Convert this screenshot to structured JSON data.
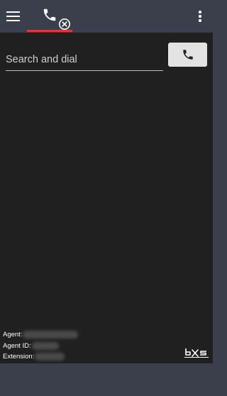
{
  "search": {
    "placeholder": "Search and dial"
  },
  "agent_info": {
    "agent_label": "Agent:",
    "agent_id_label": "Agent ID:",
    "extension_label": "Extension:"
  },
  "colors": {
    "header_bg": "#3a3f4b",
    "content_bg": "#202020",
    "tab_indicator": "#e0373e",
    "dial_button_bg": "#e3e3e3"
  },
  "icons": {
    "menu": "hamburger-menu-icon",
    "tab": "phone-icon",
    "tab_status": "disconnected-icon",
    "more": "more-vertical-icon",
    "dial": "phone-icon",
    "logo": "brand-logo"
  }
}
